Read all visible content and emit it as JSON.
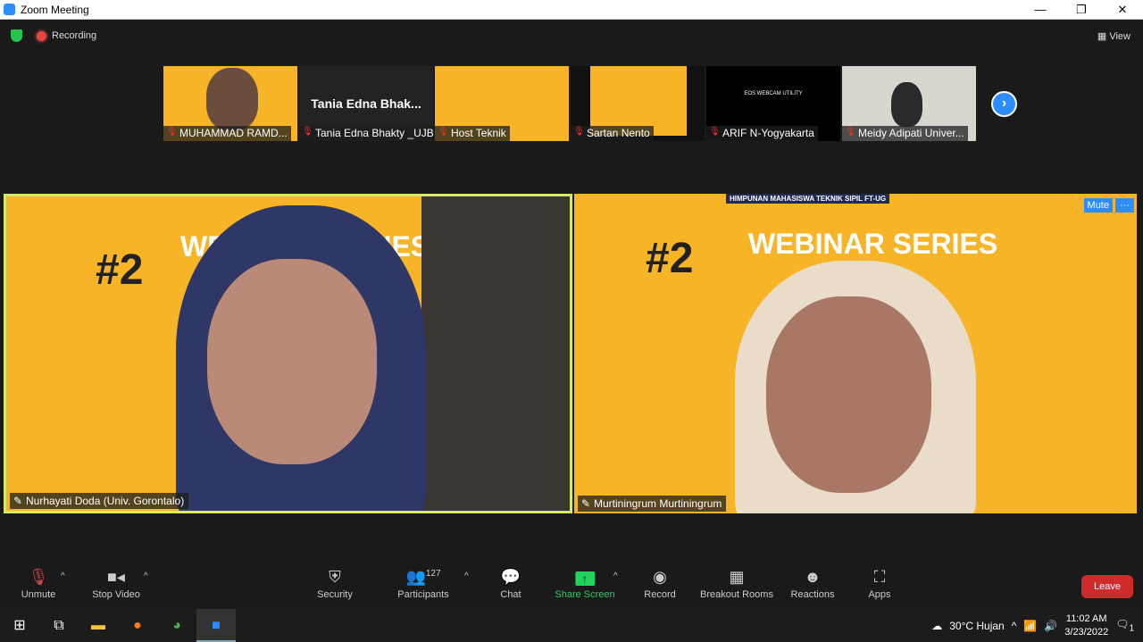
{
  "window": {
    "title": "Zoom Meeting",
    "controls": [
      "—",
      "❐",
      "✕"
    ]
  },
  "topbar": {
    "recording": "Recording",
    "view": "View"
  },
  "thumbnails": [
    {
      "name": "MUHAMMAD RAMD...",
      "video": true
    },
    {
      "name": "Tania Edna Bhakty _UJB",
      "video": false,
      "big_label": "Tania Edna Bhak..."
    },
    {
      "name": "Host Teknik",
      "video": true
    },
    {
      "name": "Sartan Nento",
      "video": true
    },
    {
      "name": "ARIF N-Yogyakarta",
      "video": true,
      "overlay": "EOS WEBCAM UTILITY"
    },
    {
      "name": "Meidy Adipati Univer...",
      "video": true
    }
  ],
  "videos": [
    {
      "name": "Nurhayati Doda (Univ. Gorontalo)",
      "active_speaker": true,
      "bg_text": "#2",
      "bg_title": "WEBINAR SERIES"
    },
    {
      "name": "Murtiningrum Murtiningrum",
      "bg_text": "#2",
      "bg_title": "WEBINAR SERIES",
      "header": "HIMPUNAN MAHASISWA TEKNIK SIPIL FT-UG",
      "mute": "Mute",
      "more": "···"
    }
  ],
  "toolbar": {
    "unmute": "Unmute",
    "stop_video": "Stop Video",
    "security": "Security",
    "participants": "Participants",
    "participant_count": "127",
    "chat": "Chat",
    "share_screen": "Share Screen",
    "record": "Record",
    "breakout": "Breakout Rooms",
    "reactions": "Reactions",
    "apps": "Apps",
    "leave": "Leave"
  },
  "taskbar": {
    "weather": "30°C  Hujan",
    "time": "11:02 AM",
    "date": "3/23/2022",
    "notifications": "1"
  },
  "colors": {
    "accent": "#2d8cff",
    "share": "#22d35a",
    "leave": "#d02b2b",
    "active_speaker": "#d7e86b",
    "slide": "#f6b426"
  }
}
